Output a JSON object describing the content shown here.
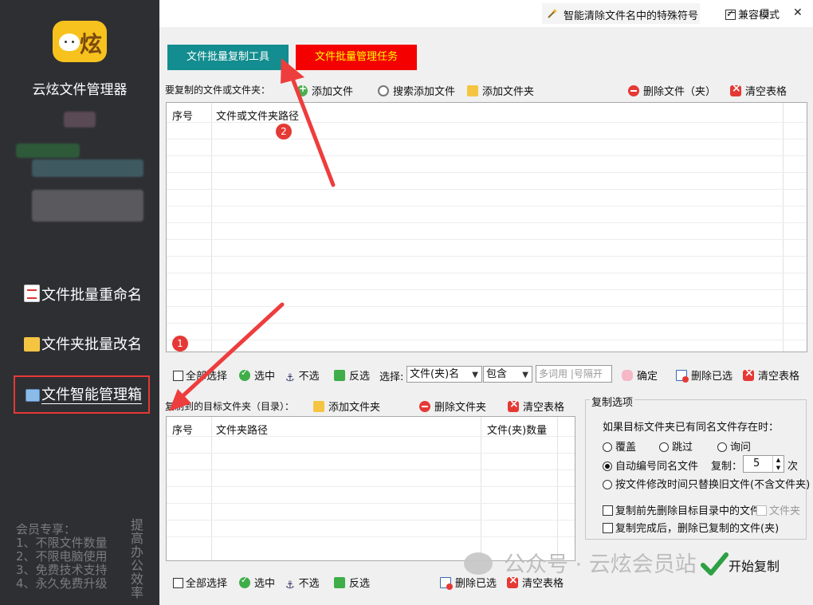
{
  "app": {
    "title": "云炫文件管理器"
  },
  "sidebar": {
    "items": [
      {
        "label": "文件批量重命名"
      },
      {
        "label": "文件夹批量改名"
      },
      {
        "label": "文件智能管理箱"
      }
    ],
    "member_lines": [
      "会员专享：",
      "1、不限文件数量",
      "2、不限电脑使用",
      "3、免费技术支持",
      "4、永久免费升级"
    ],
    "slogan": "提高办公效率"
  },
  "titlebar": {
    "mode_tab": "智能清除文件名中的特殊符号",
    "compat_label": "兼容模式",
    "compat_checked": true,
    "minimize": "−",
    "maximize": "□",
    "close": "✕"
  },
  "tabs": [
    {
      "label": "文件批量复制工具",
      "active": true
    },
    {
      "label": "文件批量管理任务",
      "active": false
    }
  ],
  "source": {
    "label": "要复制的文件或文件夹：",
    "add_file": "添加文件",
    "search_add": "搜索添加文件",
    "add_folder": "添加文件夹",
    "delete": "删除文件（夹）",
    "clear": "清空表格",
    "columns": [
      "序号",
      "文件或文件夹路径"
    ],
    "rows": []
  },
  "filter": {
    "select_all": "全部选择",
    "select": "选中",
    "deselect": "不选",
    "invert": "反选",
    "choose_label": "选择:",
    "type_value": "文件(夹)名",
    "match_value": "包含",
    "keyword_placeholder": "多词用 |号隔开",
    "ok": "确定",
    "delete_selected": "删除已选",
    "clear": "清空表格"
  },
  "target": {
    "label": "复制到的目标文件夹（目录）：",
    "add_folder": "添加文件夹",
    "delete_folder": "删除文件夹",
    "clear": "清空表格",
    "columns": [
      "序号",
      "文件夹路径",
      "文件(夹)数量"
    ],
    "rows": [],
    "select_all": "全部选择",
    "select": "选中",
    "deselect": "不选",
    "invert": "反选",
    "delete_selected": "删除已选",
    "clear2": "清空表格"
  },
  "options": {
    "title": "复制选项",
    "question": "如果目标文件夹已有同名文件存在时：",
    "overwrite": "覆盖",
    "skip": "跳过",
    "ask": "询问",
    "auto_number": "自动编号同名文件",
    "copies_label": "复制：",
    "copies_value": "5",
    "copies_unit": "次",
    "replace_old": "按文件修改时间只替换旧文件(不含文件夹)",
    "delete_before": "复制前先删除目标目录中的文件",
    "folder_opt": "文件夹",
    "delete_after": "复制完成后，删除已复制的文件(夹)",
    "selected_mode": "auto_number"
  },
  "start_label": "开始复制",
  "watermark": "公众号 · 云炫会员站",
  "annotations": {
    "badge1": "1",
    "badge2": "2"
  }
}
